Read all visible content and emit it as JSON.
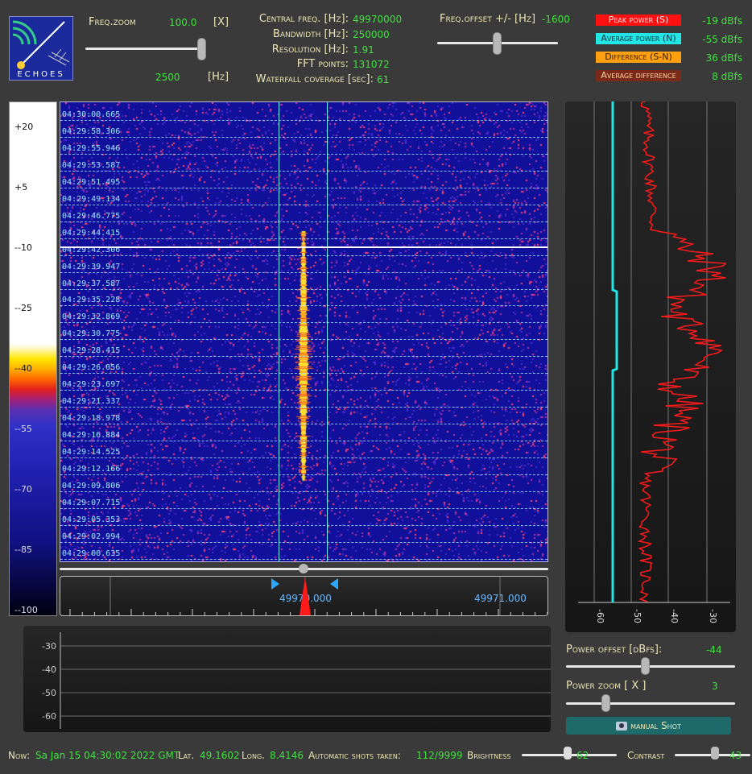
{
  "app": {
    "logo_text": "ECHOES"
  },
  "top": {
    "freq_zoom_label": "Freq.zoom",
    "freq_zoom_value": "100.0",
    "freq_zoom_unit": "[X]",
    "span_value": "2500",
    "span_unit": "[Hz]",
    "central_freq_label": "Central freq. [Hz]:",
    "central_freq_value": "49970000",
    "bandwidth_label": "Bandwidth  [Hz]:",
    "bandwidth_value": "250000",
    "resolution_label": "Resolution [Hz]:",
    "resolution_value": "1.91",
    "fft_label": "FFT points:",
    "fft_value": "131072",
    "waterfall_label": "Waterfall coverage [sec]:",
    "waterfall_value": "61",
    "freq_offset_label": "Freq.offset +/- [Hz]",
    "freq_offset_value": "-1600"
  },
  "legend": [
    {
      "label": "Peak power (S)",
      "value": "-19 dBfs",
      "bg": "#ff1111",
      "fg": "#ffe8e8"
    },
    {
      "label": "Average power (N)",
      "value": "-55 dBfs",
      "bg": "#22e6e6",
      "fg": "#0a3040"
    },
    {
      "label": "Difference (S-N)",
      "value": "36 dBfs",
      "bg": "#ffa010",
      "fg": "#3a2000"
    },
    {
      "label": "Average difference",
      "value": "8 dBfs",
      "bg": "#7a2a18",
      "fg": "#ffd0a0"
    }
  ],
  "colorbar": {
    "ticks": [
      "+20",
      "+5",
      "--10",
      "--25",
      "--40",
      "--55",
      "--70",
      "--85",
      "--100"
    ]
  },
  "waterfall": {
    "timestamps": [
      "04:30:00.665",
      "04:29:58.306",
      "04:29:55.946",
      "04:29:53.587",
      "04:29:51.495",
      "04:29:49.134",
      "04:29:46.775",
      "04:29:44.415",
      "04:29:42.306",
      "04:29:39.947",
      "04:29:37.587",
      "04:29:35.228",
      "04:29:32.869",
      "04:29:30.775",
      "04:29:28.415",
      "04:29:26.056",
      "04:29:23.697",
      "04:29:21.337",
      "04:29:18.978",
      "04:29:16.884",
      "04:29:14.525",
      "04:29:12.166",
      "04:29:09.806",
      "04:29:07.715",
      "04:29:05.353",
      "04:29:02.994",
      "04:29:00.635"
    ]
  },
  "freq_axis": {
    "labels": [
      "49970.000",
      "49971.000"
    ]
  },
  "power_chart": {
    "x_ticks": [
      "-60",
      "-50",
      "-40",
      "-30"
    ]
  },
  "spectrum_chart": {
    "y_ticks": [
      "-30",
      "-40",
      "-50",
      "-60"
    ]
  },
  "controls": {
    "power_offset_label": "Power offset [dBfs]:",
    "power_offset_value": "-44",
    "power_zoom_label": "Power zoom  [ X ]",
    "power_zoom_value": "3",
    "manual_shot_label": "manual Shot"
  },
  "status": {
    "now_label": "Now:",
    "now_value": "Sa Jan 15 04:30:02 2022 GMT",
    "lat_label": "Lat.",
    "lat_value": "49.1602",
    "long_label": "Long.",
    "long_value": "8.4146",
    "shots_label": "Automatic shots taken:",
    "shots_value": "112/9999",
    "brightness_label": "Brightness",
    "brightness_value": "62",
    "contrast_label": "Contrast",
    "contrast_value": "43"
  },
  "colors": {
    "accent_green": "#3ce43c",
    "label_cream": "#ece6b4",
    "waterfall_bg": "#10109a",
    "cyan": "#22e6e6",
    "red": "#ff1a1a"
  }
}
